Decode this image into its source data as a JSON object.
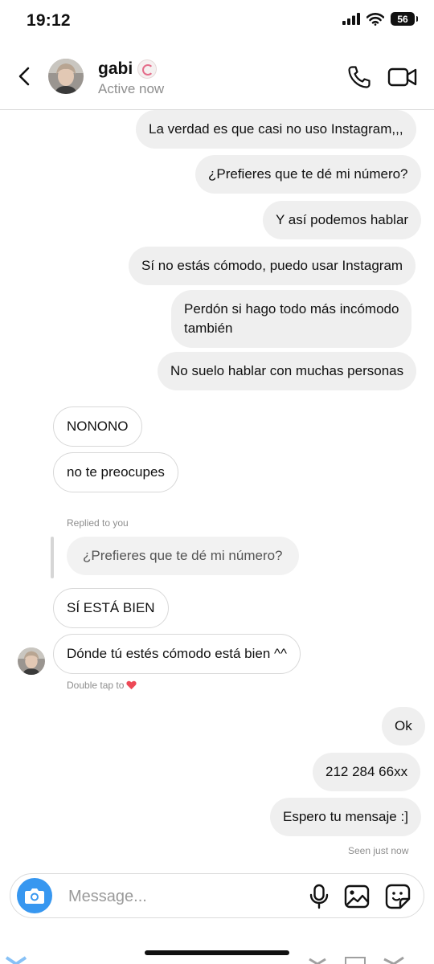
{
  "status_bar": {
    "time": "19:12",
    "battery": "56"
  },
  "header": {
    "contact_name": "gabi",
    "contact_status": "Active now"
  },
  "messages": [
    {
      "side": "out",
      "text": "La verdad es que casi no uso Instagram,,,"
    },
    {
      "side": "out",
      "text": "¿Prefieres que te dé mi número?"
    },
    {
      "side": "out",
      "text": "Y así podemos hablar"
    },
    {
      "side": "out",
      "text": "Sí no estás cómodo, puedo usar Instagram"
    },
    {
      "side": "out",
      "text_line1": "Perdón si hago todo más incómodo",
      "text_line2": "también"
    },
    {
      "side": "out",
      "text": "No suelo hablar con muchas personas"
    },
    {
      "side": "in",
      "text": "NONONO"
    },
    {
      "side": "in",
      "text": "no te preocupes"
    },
    {
      "side": "in",
      "text": "SÍ ESTÁ BIEN"
    },
    {
      "side": "in",
      "text": "Dónde tú estés cómodo está bien ^^"
    },
    {
      "side": "out",
      "text": "Ok"
    },
    {
      "side": "out",
      "text": "212 284 66xx"
    },
    {
      "side": "out",
      "text": "Espero tu mensaje :]"
    }
  ],
  "reply": {
    "label": "Replied to you",
    "quoted_text": "¿Prefieres que te dé mi número?"
  },
  "hints": {
    "double_tap": "Double tap to",
    "seen": "Seen just now"
  },
  "composer": {
    "placeholder": "Message..."
  },
  "colors": {
    "accent": "#3797f0",
    "out_bubble": "#efefef",
    "muted": "#8e8e8e",
    "heart": "#ed4956"
  },
  "icons": [
    "back-icon",
    "phone-icon",
    "video-icon",
    "camera-icon",
    "mic-icon",
    "gallery-icon",
    "sticker-icon",
    "heart-icon"
  ]
}
